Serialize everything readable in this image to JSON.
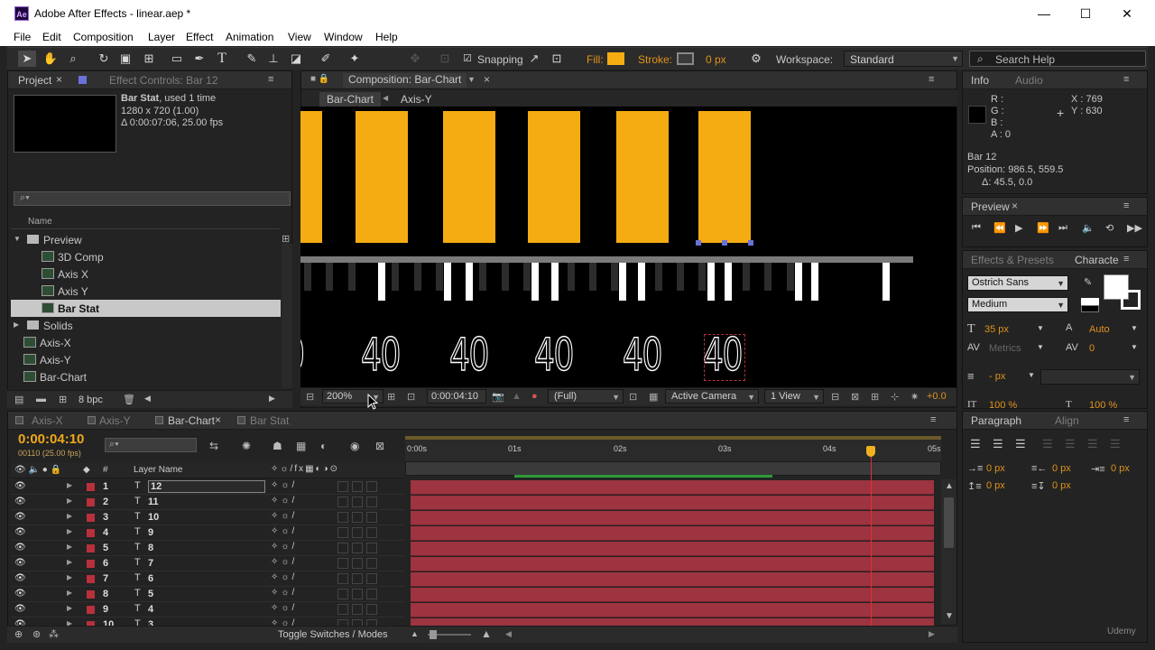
{
  "window": {
    "app_icon": "Ae",
    "title": "Adobe After Effects - linear.aep *",
    "minimize": "—",
    "maximize": "☐",
    "close": "✕"
  },
  "menu": [
    "File",
    "Edit",
    "Composition",
    "Layer",
    "Effect",
    "Animation",
    "View",
    "Window",
    "Help"
  ],
  "toolbar": {
    "snapping_label": "Snapping",
    "fill_label": "Fill:",
    "fill_color": "#f4ac12",
    "stroke_label": "Stroke:",
    "stroke_value": "0 px",
    "workspace_label": "Workspace:",
    "workspace_value": "Standard",
    "search_placeholder": "Search Help"
  },
  "project_panel": {
    "tab_project": "Project",
    "tab_effect_controls": "Effect Controls: Bar 12",
    "item_name": "Bar Stat",
    "item_used": ", used 1 time",
    "item_size": "1280 x 720 (1.00)",
    "item_duration": "Δ 0:00:07:06, 25.00 fps",
    "search_placeholder": "",
    "col_name": "Name",
    "bpc": "8 bpc",
    "items": [
      {
        "name": "Preview",
        "type": "folder",
        "indent": 0,
        "open": true
      },
      {
        "name": "3D Comp",
        "type": "comp",
        "indent": 1
      },
      {
        "name": "Axis X",
        "type": "comp",
        "indent": 1
      },
      {
        "name": "Axis Y",
        "type": "comp",
        "indent": 1
      },
      {
        "name": "Bar Stat",
        "type": "comp",
        "indent": 1,
        "selected": true
      },
      {
        "name": "Solids",
        "type": "folder",
        "indent": 0,
        "open": false
      },
      {
        "name": "Axis-X",
        "type": "comp",
        "indent": 0
      },
      {
        "name": "Axis-Y",
        "type": "comp",
        "indent": 0
      },
      {
        "name": "Bar-Chart",
        "type": "comp",
        "indent": 0
      }
    ]
  },
  "composition": {
    "tab_label": "Composition: Bar-Chart",
    "breadcrumb_1": "Bar-Chart",
    "breadcrumb_2": "Axis-Y",
    "bar_color": "#f4ac12",
    "bar_labels": [
      "0",
      "40",
      "40",
      "40",
      "40",
      "40"
    ],
    "footer": {
      "zoom": "200%",
      "timecode": "0:00:04:10",
      "resolution": "(Full)",
      "camera": "Active Camera",
      "views": "1 View",
      "exposure": "+0.0"
    }
  },
  "info_panel": {
    "tab_info": "Info",
    "tab_audio": "Audio",
    "r": "R :",
    "g": "G :",
    "b": "B :",
    "a": "A : 0",
    "x": "X : 769",
    "y": "Y : 630",
    "layer": "Bar 12",
    "position": "Position: 986.5, 559.5",
    "delta": "Δ: 45.5, 0.0"
  },
  "preview_panel": {
    "tab": "Preview"
  },
  "effects_panel": {
    "tab_effects": "Effects & Presets",
    "tab_character": "Characte"
  },
  "character_panel": {
    "font": "Ostrich Sans",
    "style": "Medium",
    "size": "35 px",
    "leading": "Auto",
    "kerning": "Metrics",
    "tracking": "0",
    "stroke_width": "- px",
    "vscale": "100 %",
    "hscale": "100 %"
  },
  "paragraph_panel": {
    "tab_paragraph": "Paragraph",
    "tab_align": "Align",
    "indent_left": "0 px",
    "indent_right": "0 px",
    "indent_first": "0 px",
    "space_before": "0 px",
    "space_after": "0 px"
  },
  "timeline": {
    "tabs": [
      "Axis-X",
      "Axis-Y",
      "Bar-Chart",
      "Bar Stat"
    ],
    "active_tab": 2,
    "timecode": "0:00:04:10",
    "frames": "00110 (25.00 fps)",
    "col_layer_name": "Layer Name",
    "col_num": "#",
    "toggle_label": "Toggle Switches / Modes",
    "ruler": [
      "0:00s",
      "01s",
      "02s",
      "03s",
      "04s",
      "05s"
    ],
    "playhead_fraction": 0.88,
    "layers": [
      {
        "num": "1",
        "name": "12",
        "selected": true
      },
      {
        "num": "2",
        "name": "11"
      },
      {
        "num": "3",
        "name": "10"
      },
      {
        "num": "4",
        "name": "9"
      },
      {
        "num": "5",
        "name": "8"
      },
      {
        "num": "6",
        "name": "7"
      },
      {
        "num": "7",
        "name": "6"
      },
      {
        "num": "8",
        "name": "5"
      },
      {
        "num": "9",
        "name": "4"
      },
      {
        "num": "10",
        "name": "3"
      }
    ],
    "track_color": "#9d3440"
  },
  "watermark": "Udemy"
}
